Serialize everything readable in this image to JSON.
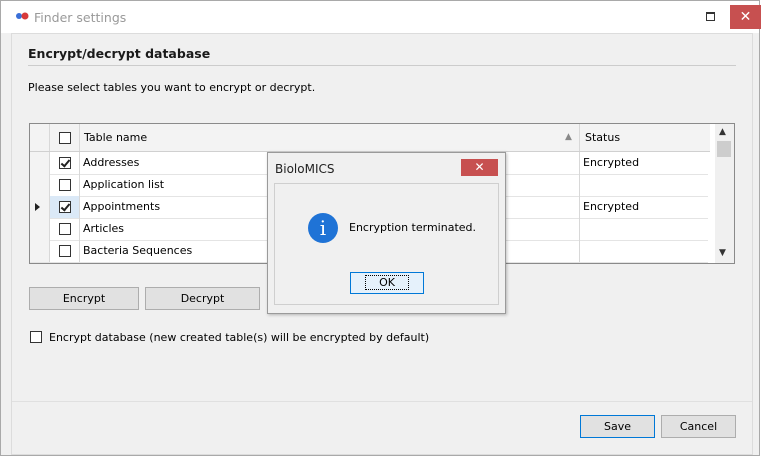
{
  "window": {
    "title": "Finder settings",
    "close_glyph": "✕"
  },
  "section": {
    "title": "Encrypt/decrypt database",
    "instructions": "Please select tables you want to encrypt or decrypt."
  },
  "grid": {
    "columns": [
      "Table name",
      "Status"
    ],
    "rows": [
      {
        "name": "Addresses",
        "checked": true,
        "status": "Encrypted",
        "current": false
      },
      {
        "name": "Application list",
        "checked": false,
        "status": "",
        "current": false
      },
      {
        "name": "Appointments",
        "checked": true,
        "status": "Encrypted",
        "current": true
      },
      {
        "name": "Articles",
        "checked": false,
        "status": "",
        "current": false
      },
      {
        "name": "Bacteria Sequences",
        "checked": false,
        "status": "",
        "current": false
      }
    ]
  },
  "buttons": {
    "encrypt": "Encrypt",
    "decrypt": "Decrypt",
    "save": "Save",
    "cancel": "Cancel"
  },
  "encrypt_db": {
    "label": "Encrypt database (new created table(s) will be encrypted by default)",
    "checked": false
  },
  "dialog": {
    "title": "BioloMICS",
    "message": "Encryption terminated.",
    "ok": "OK",
    "icon": "i"
  },
  "colors": {
    "close": "#c75050",
    "info": "#1f73d6",
    "primary_border": "#0078d7"
  }
}
